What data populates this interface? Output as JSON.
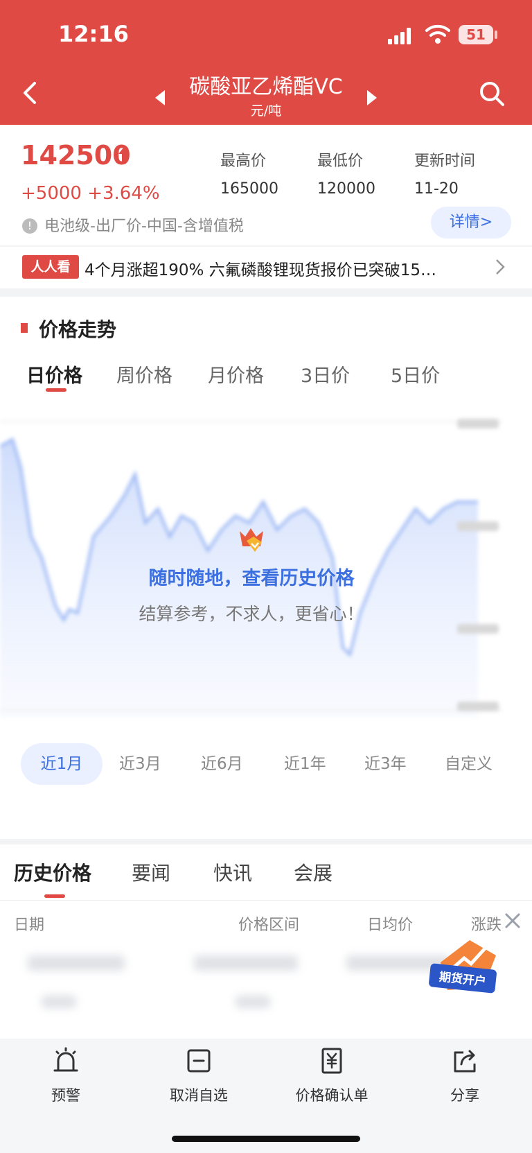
{
  "status": {
    "time": "12:16",
    "battery": "51"
  },
  "header": {
    "title": "碳酸亚乙烯酯VC",
    "unit": "元/吨"
  },
  "price": {
    "current": "142500",
    "change": "+5000 +3.64%",
    "high_label": "最高价",
    "high": "165000",
    "low_label": "最低价",
    "low": "120000",
    "updated_label": "更新时间",
    "updated": "11-20",
    "note": "电池级-出厂价-中国-含增值税",
    "detail_button": "详情>"
  },
  "news": {
    "badge": "人人看",
    "text": "4个月涨超190% 六氟磷酸锂现货报价已突破15…"
  },
  "trend": {
    "title": "价格走势",
    "tabs": [
      "日价格",
      "周价格",
      "月价格",
      "3日价",
      "5日价"
    ],
    "active_tab": 0,
    "overlay_title": "随时随地，查看历史价格",
    "overlay_subtitle": "结算参考，不求人，更省心！",
    "ranges": [
      "近1月",
      "近3月",
      "近6月",
      "近1年",
      "近3年",
      "自定义"
    ],
    "active_range": 0
  },
  "history": {
    "tabs": [
      "历史价格",
      "要闻",
      "快讯",
      "会展"
    ],
    "active_tab": 0,
    "columns": [
      "日期",
      "价格区间",
      "日均价",
      "涨跌"
    ],
    "futures_label": "期货开户"
  },
  "bottom": {
    "items": [
      "预警",
      "取消自选",
      "价格确认单",
      "分享"
    ]
  },
  "colors": {
    "brand_red": "#e04a45",
    "accent_blue": "#3c6fe0"
  }
}
